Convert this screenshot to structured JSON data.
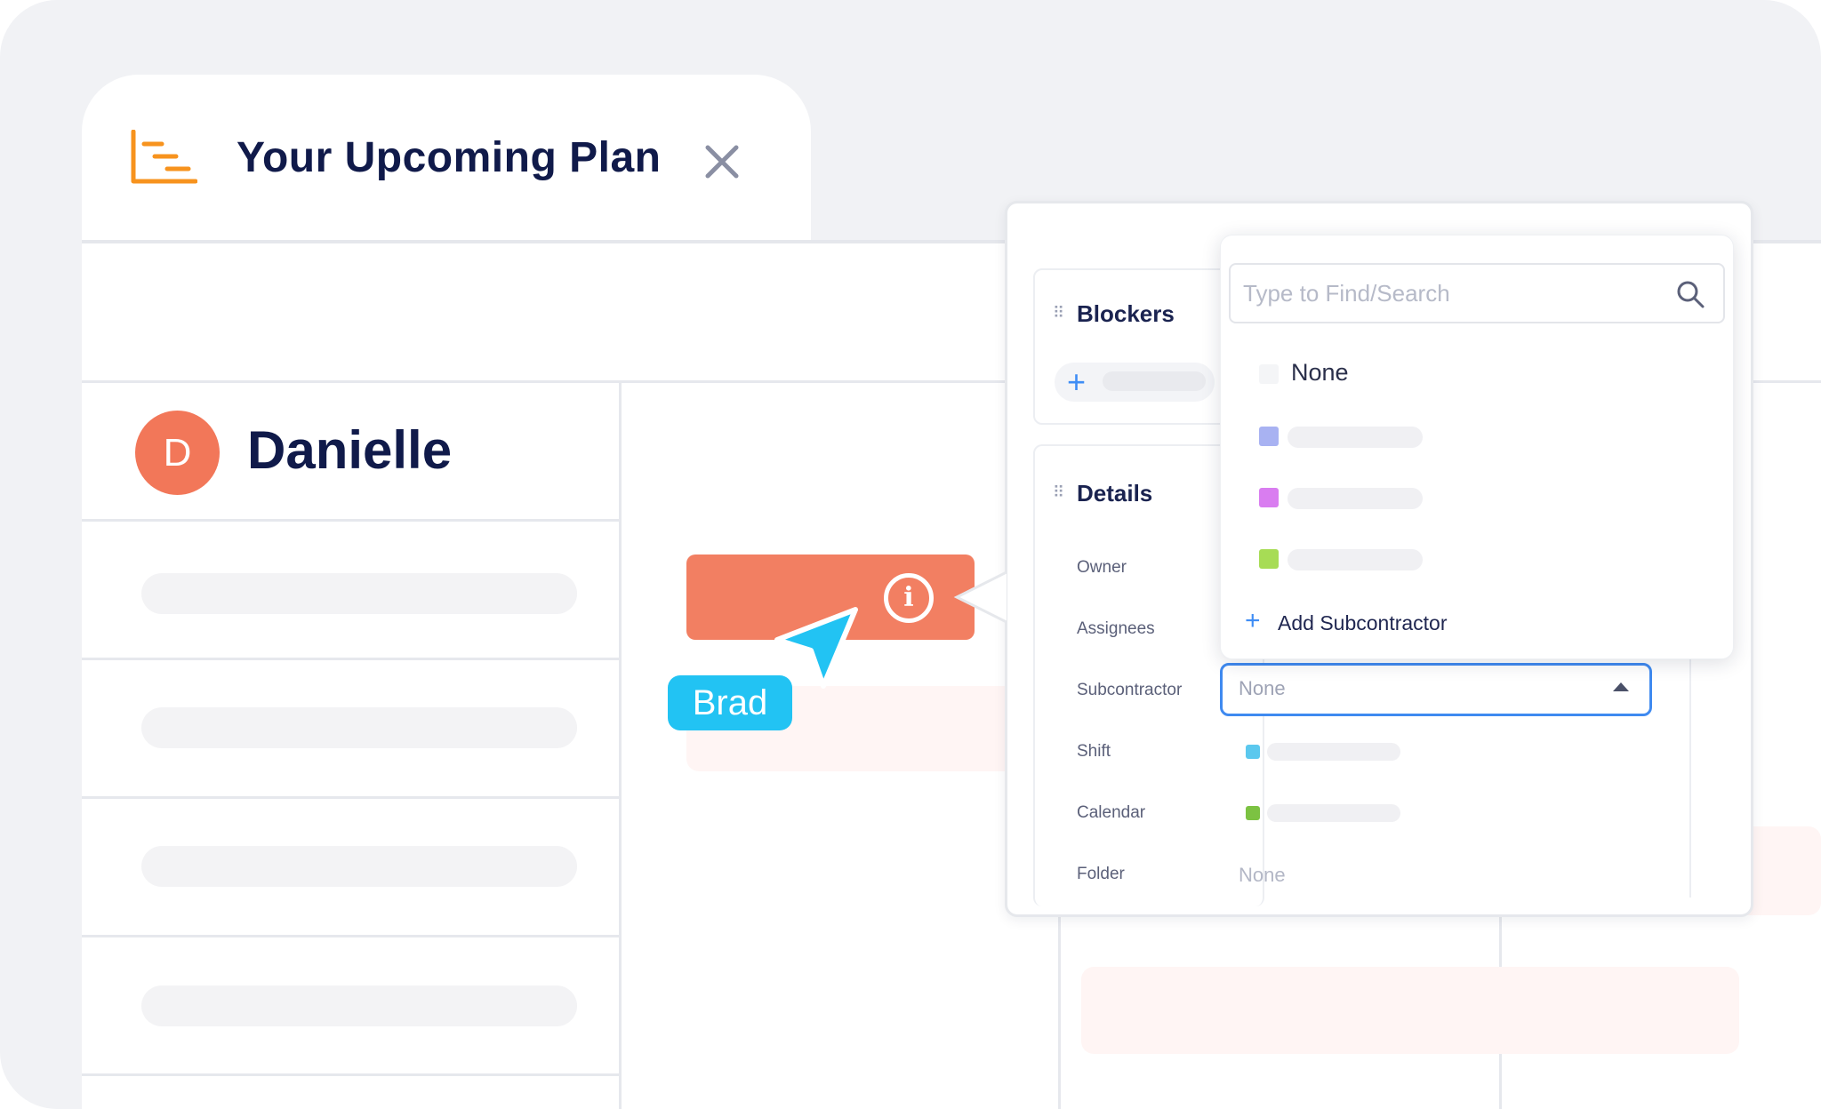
{
  "plan_tab": {
    "title": "Your Upcoming Plan",
    "icon": "gantt-chart-icon",
    "close_icon": "close-icon",
    "accent_color": "#f7931e"
  },
  "timeline": {
    "person": {
      "initial": "D",
      "name": "Danielle",
      "avatar_color": "#f27759"
    },
    "task_bar_color": "#f27f62",
    "task_info_icon": "i",
    "collaborator": {
      "name": "Brad",
      "color": "#22c3f3"
    }
  },
  "details_panel": {
    "sections": {
      "blockers": {
        "title": "Blockers",
        "add_icon": "+"
      },
      "details": {
        "title": "Details"
      }
    },
    "fields": {
      "owner": {
        "label": "Owner"
      },
      "assignees": {
        "label": "Assignees"
      },
      "subcontractor": {
        "label": "Subcontractor",
        "value": "None"
      },
      "shift": {
        "label": "Shift",
        "swatch_color": "#5bc8ee"
      },
      "calendar": {
        "label": "Calendar",
        "swatch_color": "#7cc242"
      },
      "folder": {
        "label": "Folder",
        "value": "None"
      }
    }
  },
  "subcontractor_dropdown": {
    "search_placeholder": "Type to Find/Search",
    "options": [
      {
        "label": "None",
        "swatch_color": "#f4f5f7"
      },
      {
        "label": "",
        "swatch_color": "#a8b2f2"
      },
      {
        "label": "",
        "swatch_color": "#d97df0"
      },
      {
        "label": "",
        "swatch_color": "#a7dc55"
      }
    ],
    "add_label": "Add Subcontractor",
    "add_icon": "+"
  }
}
